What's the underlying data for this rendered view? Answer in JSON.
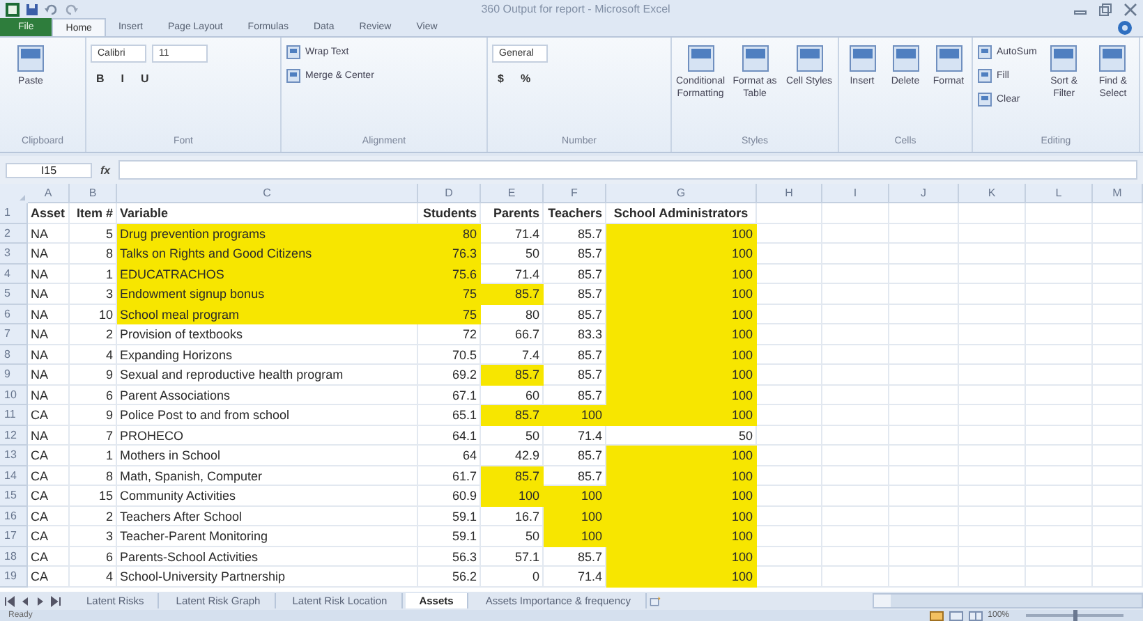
{
  "window": {
    "title": "360 Output for report - Microsoft Excel"
  },
  "ribbon_tabs": [
    {
      "label": "File",
      "kind": "file",
      "selected": false
    },
    {
      "label": "Home",
      "kind": "tab",
      "selected": true
    },
    {
      "label": "Insert",
      "kind": "tab",
      "selected": false
    },
    {
      "label": "Page Layout",
      "kind": "tab",
      "selected": false
    },
    {
      "label": "Formulas",
      "kind": "tab",
      "selected": false
    },
    {
      "label": "Data",
      "kind": "tab",
      "selected": false
    },
    {
      "label": "Review",
      "kind": "tab",
      "selected": false
    },
    {
      "label": "View",
      "kind": "tab",
      "selected": false
    }
  ],
  "ribbon_groups": [
    {
      "label": "Clipboard",
      "items": [
        {
          "kind": "large",
          "label": "Paste"
        }
      ]
    },
    {
      "label": "Font",
      "items": [
        {
          "kind": "stack",
          "lines": [
            [
              {
                "kind": "field",
                "label": "Calibri"
              },
              {
                "kind": "field",
                "label": "11"
              }
            ],
            [
              {
                "kind": "glyph",
                "label": "B"
              },
              {
                "kind": "glyph",
                "label": "I"
              },
              {
                "kind": "glyph",
                "label": "U"
              }
            ]
          ]
        }
      ]
    },
    {
      "label": "Alignment",
      "items": [
        {
          "kind": "stack",
          "lines": [
            [
              {
                "kind": "small",
                "label": "Wrap Text"
              }
            ],
            [
              {
                "kind": "small",
                "label": "Merge & Center"
              }
            ]
          ]
        }
      ]
    },
    {
      "label": "Number",
      "items": [
        {
          "kind": "stack",
          "lines": [
            [
              {
                "kind": "field",
                "label": "General"
              }
            ],
            [
              {
                "kind": "glyph",
                "label": "$"
              },
              {
                "kind": "glyph",
                "label": "%"
              }
            ]
          ]
        }
      ]
    },
    {
      "label": "Styles",
      "items": [
        {
          "kind": "large",
          "label": "Conditional Formatting"
        },
        {
          "kind": "large",
          "label": "Format as Table"
        },
        {
          "kind": "large",
          "label": "Cell Styles"
        }
      ]
    },
    {
      "label": "Cells",
      "items": [
        {
          "kind": "large",
          "label": "Insert"
        },
        {
          "kind": "large",
          "label": "Delete"
        },
        {
          "kind": "large",
          "label": "Format"
        }
      ]
    },
    {
      "label": "Editing",
      "items": [
        {
          "kind": "stack",
          "lines": [
            [
              {
                "kind": "small",
                "label": "AutoSum"
              }
            ],
            [
              {
                "kind": "small",
                "label": "Fill"
              }
            ],
            [
              {
                "kind": "small",
                "label": "Clear"
              }
            ]
          ]
        },
        {
          "kind": "large",
          "label": "Sort & Filter"
        },
        {
          "kind": "large",
          "label": "Find & Select"
        }
      ]
    }
  ],
  "formula_bar": {
    "name_box": "I15",
    "function_label": "fx"
  },
  "sheet": {
    "columns": [
      "A",
      "B",
      "C",
      "D",
      "E",
      "F",
      "G",
      "H",
      "I",
      "J",
      "K",
      "L",
      "M"
    ],
    "rows": [
      {
        "number": "1",
        "kind": "header",
        "cells": [
          {
            "text": "Asset",
            "highlighted": false
          },
          {
            "text": "Item #",
            "highlighted": false
          },
          {
            "text": "Variable",
            "highlighted": false
          },
          {
            "text": "Students",
            "highlighted": false
          },
          {
            "text": "Parents",
            "highlighted": false
          },
          {
            "text": "Teachers",
            "highlighted": false
          },
          {
            "text": "School Administrators",
            "highlighted": false
          }
        ]
      },
      {
        "number": "2",
        "kind": "data",
        "cells": [
          {
            "text": "NA",
            "highlighted": false
          },
          {
            "text": "5",
            "highlighted": false
          },
          {
            "text": "Drug prevention programs",
            "highlighted": true
          },
          {
            "text": "80",
            "highlighted": true
          },
          {
            "text": "71.4",
            "highlighted": false
          },
          {
            "text": "85.7",
            "highlighted": false
          },
          {
            "text": "100",
            "highlighted": true
          }
        ]
      },
      {
        "number": "3",
        "kind": "data",
        "cells": [
          {
            "text": "NA",
            "highlighted": false
          },
          {
            "text": "8",
            "highlighted": false
          },
          {
            "text": "Talks on Rights and Good Citizens",
            "highlighted": true
          },
          {
            "text": "76.3",
            "highlighted": true
          },
          {
            "text": "50",
            "highlighted": false
          },
          {
            "text": "85.7",
            "highlighted": false
          },
          {
            "text": "100",
            "highlighted": true
          }
        ]
      },
      {
        "number": "4",
        "kind": "data",
        "cells": [
          {
            "text": "NA",
            "highlighted": false
          },
          {
            "text": "1",
            "highlighted": false
          },
          {
            "text": "EDUCATRACHOS",
            "highlighted": true
          },
          {
            "text": "75.6",
            "highlighted": true
          },
          {
            "text": "71.4",
            "highlighted": false
          },
          {
            "text": "85.7",
            "highlighted": false
          },
          {
            "text": "100",
            "highlighted": true
          }
        ]
      },
      {
        "number": "5",
        "kind": "data",
        "cells": [
          {
            "text": "NA",
            "highlighted": false
          },
          {
            "text": "3",
            "highlighted": false
          },
          {
            "text": "Endowment signup bonus",
            "highlighted": true
          },
          {
            "text": "75",
            "highlighted": true
          },
          {
            "text": "85.7",
            "highlighted": true
          },
          {
            "text": "85.7",
            "highlighted": false
          },
          {
            "text": "100",
            "highlighted": true
          }
        ]
      },
      {
        "number": "6",
        "kind": "data",
        "cells": [
          {
            "text": "NA",
            "highlighted": false
          },
          {
            "text": "10",
            "highlighted": false
          },
          {
            "text": "School meal program",
            "highlighted": true
          },
          {
            "text": "75",
            "highlighted": true
          },
          {
            "text": "80",
            "highlighted": false
          },
          {
            "text": "85.7",
            "highlighted": false
          },
          {
            "text": "100",
            "highlighted": true
          }
        ]
      },
      {
        "number": "7",
        "kind": "data",
        "cells": [
          {
            "text": "NA",
            "highlighted": false
          },
          {
            "text": "2",
            "highlighted": false
          },
          {
            "text": "Provision of textbooks",
            "highlighted": false
          },
          {
            "text": "72",
            "highlighted": false
          },
          {
            "text": "66.7",
            "highlighted": false
          },
          {
            "text": "83.3",
            "highlighted": false
          },
          {
            "text": "100",
            "highlighted": true
          }
        ]
      },
      {
        "number": "8",
        "kind": "data",
        "cells": [
          {
            "text": "NA",
            "highlighted": false
          },
          {
            "text": "4",
            "highlighted": false
          },
          {
            "text": "Expanding Horizons",
            "highlighted": false
          },
          {
            "text": "70.5",
            "highlighted": false
          },
          {
            "text": "7.4",
            "highlighted": false
          },
          {
            "text": "85.7",
            "highlighted": false
          },
          {
            "text": "100",
            "highlighted": true
          }
        ]
      },
      {
        "number": "9",
        "kind": "data",
        "cells": [
          {
            "text": "NA",
            "highlighted": false
          },
          {
            "text": "9",
            "highlighted": false
          },
          {
            "text": "Sexual and reproductive health program",
            "highlighted": false
          },
          {
            "text": "69.2",
            "highlighted": false
          },
          {
            "text": "85.7",
            "highlighted": true
          },
          {
            "text": "85.7",
            "highlighted": false
          },
          {
            "text": "100",
            "highlighted": true
          }
        ]
      },
      {
        "number": "10",
        "kind": "data",
        "cells": [
          {
            "text": "NA",
            "highlighted": false
          },
          {
            "text": "6",
            "highlighted": false
          },
          {
            "text": "Parent Associations",
            "highlighted": false
          },
          {
            "text": "67.1",
            "highlighted": false
          },
          {
            "text": "60",
            "highlighted": false
          },
          {
            "text": "85.7",
            "highlighted": false
          },
          {
            "text": "100",
            "highlighted": true
          }
        ]
      },
      {
        "number": "11",
        "kind": "data",
        "cells": [
          {
            "text": "CA",
            "highlighted": false
          },
          {
            "text": "9",
            "highlighted": false
          },
          {
            "text": "Police Post to and from school",
            "highlighted": false
          },
          {
            "text": "65.1",
            "highlighted": false
          },
          {
            "text": "85.7",
            "highlighted": true
          },
          {
            "text": "100",
            "highlighted": true
          },
          {
            "text": "100",
            "highlighted": true
          }
        ]
      },
      {
        "number": "12",
        "kind": "data",
        "cells": [
          {
            "text": "NA",
            "highlighted": false
          },
          {
            "text": "7",
            "highlighted": false
          },
          {
            "text": "PROHECO",
            "highlighted": false
          },
          {
            "text": "64.1",
            "highlighted": false
          },
          {
            "text": "50",
            "highlighted": false
          },
          {
            "text": "71.4",
            "highlighted": false
          },
          {
            "text": "50",
            "highlighted": false
          }
        ]
      },
      {
        "number": "13",
        "kind": "data",
        "cells": [
          {
            "text": "CA",
            "highlighted": false
          },
          {
            "text": "1",
            "highlighted": false
          },
          {
            "text": "Mothers in School",
            "highlighted": false
          },
          {
            "text": "64",
            "highlighted": false
          },
          {
            "text": "42.9",
            "highlighted": false
          },
          {
            "text": "85.7",
            "highlighted": false
          },
          {
            "text": "100",
            "highlighted": true
          }
        ]
      },
      {
        "number": "14",
        "kind": "data",
        "cells": [
          {
            "text": "CA",
            "highlighted": false
          },
          {
            "text": "8",
            "highlighted": false
          },
          {
            "text": "Math, Spanish, Computer",
            "highlighted": false
          },
          {
            "text": "61.7",
            "highlighted": false
          },
          {
            "text": "85.7",
            "highlighted": true
          },
          {
            "text": "85.7",
            "highlighted": false
          },
          {
            "text": "100",
            "highlighted": true
          }
        ]
      },
      {
        "number": "15",
        "kind": "data",
        "cells": [
          {
            "text": "CA",
            "highlighted": false
          },
          {
            "text": "15",
            "highlighted": false
          },
          {
            "text": "Community Activities",
            "highlighted": false
          },
          {
            "text": "60.9",
            "highlighted": false
          },
          {
            "text": "100",
            "highlighted": true
          },
          {
            "text": "100",
            "highlighted": true
          },
          {
            "text": "100",
            "highlighted": true
          }
        ]
      },
      {
        "number": "16",
        "kind": "data",
        "cells": [
          {
            "text": "CA",
            "highlighted": false
          },
          {
            "text": "2",
            "highlighted": false
          },
          {
            "text": "Teachers After School",
            "highlighted": false
          },
          {
            "text": "59.1",
            "highlighted": false
          },
          {
            "text": "16.7",
            "highlighted": false
          },
          {
            "text": "100",
            "highlighted": true
          },
          {
            "text": "100",
            "highlighted": true
          }
        ]
      },
      {
        "number": "17",
        "kind": "data",
        "cells": [
          {
            "text": "CA",
            "highlighted": false
          },
          {
            "text": "3",
            "highlighted": false
          },
          {
            "text": "Teacher-Parent Monitoring",
            "highlighted": false
          },
          {
            "text": "59.1",
            "highlighted": false
          },
          {
            "text": "50",
            "highlighted": false
          },
          {
            "text": "100",
            "highlighted": true
          },
          {
            "text": "100",
            "highlighted": true
          }
        ]
      },
      {
        "number": "18",
        "kind": "data",
        "cells": [
          {
            "text": "CA",
            "highlighted": false
          },
          {
            "text": "6",
            "highlighted": false
          },
          {
            "text": "Parents-School Activities",
            "highlighted": false
          },
          {
            "text": "56.3",
            "highlighted": false
          },
          {
            "text": "57.1",
            "highlighted": false
          },
          {
            "text": "85.7",
            "highlighted": false
          },
          {
            "text": "100",
            "highlighted": true
          }
        ]
      },
      {
        "number": "19",
        "kind": "data",
        "cells": [
          {
            "text": "CA",
            "highlighted": false
          },
          {
            "text": "4",
            "highlighted": false
          },
          {
            "text": "School-University Partnership",
            "highlighted": false
          },
          {
            "text": "56.2",
            "highlighted": false
          },
          {
            "text": "0",
            "highlighted": false
          },
          {
            "text": "71.4",
            "highlighted": false
          },
          {
            "text": "100",
            "highlighted": true
          }
        ]
      }
    ]
  },
  "sheet_tabs": [
    {
      "label": "Latent Risks",
      "selected": false
    },
    {
      "label": "Latent Risk Graph",
      "selected": false
    },
    {
      "label": "Latent Risk Location",
      "selected": false
    },
    {
      "label": "Assets",
      "selected": true
    },
    {
      "label": "Assets Importance & frequency",
      "selected": false
    }
  ],
  "status_bar": {
    "text": "Ready",
    "zoom": "100%",
    "zoom_slider": {
      "level": 0.5
    }
  }
}
